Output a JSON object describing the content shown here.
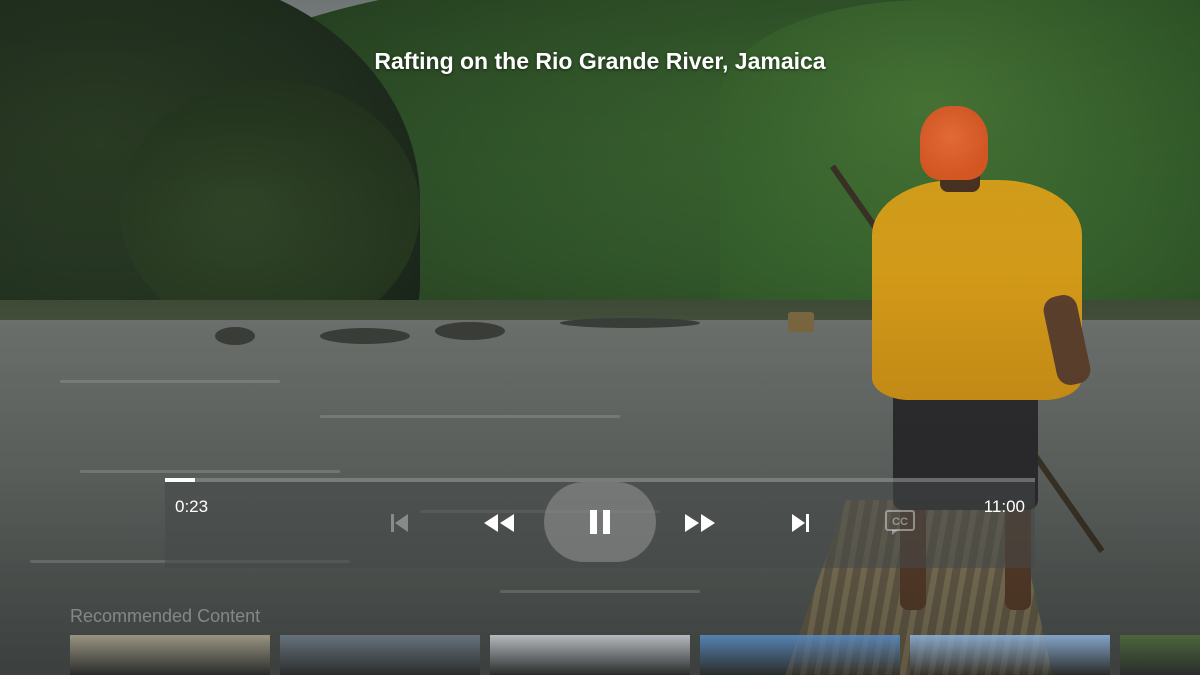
{
  "video": {
    "title": "Rafting on the Rio Grande River, Jamaica"
  },
  "player": {
    "elapsed": "0:23",
    "duration": "11:00",
    "progress_fraction": 0.035,
    "state": "playing",
    "icons": {
      "skip_previous": "skip-previous-icon",
      "rewind": "rewind-icon",
      "pause": "pause-icon",
      "fast_forward": "fast-forward-icon",
      "skip_next": "skip-next-icon",
      "closed_captions": "closed-captions-icon"
    },
    "skip_previous_enabled": false,
    "captions_enabled": false
  },
  "recommended": {
    "heading": "Recommended Content",
    "items": [
      {
        "thumb_color": "#a8a18c"
      },
      {
        "thumb_color": "#6d7a86"
      },
      {
        "thumb_color": "#c9cdd3"
      },
      {
        "thumb_color": "#5a8cc4"
      },
      {
        "thumb_color": "#8fb4de"
      },
      {
        "thumb_color": "#4e6b3b"
      }
    ]
  },
  "colors": {
    "progress_fill": "#ffffff",
    "text": "#ffffff"
  }
}
